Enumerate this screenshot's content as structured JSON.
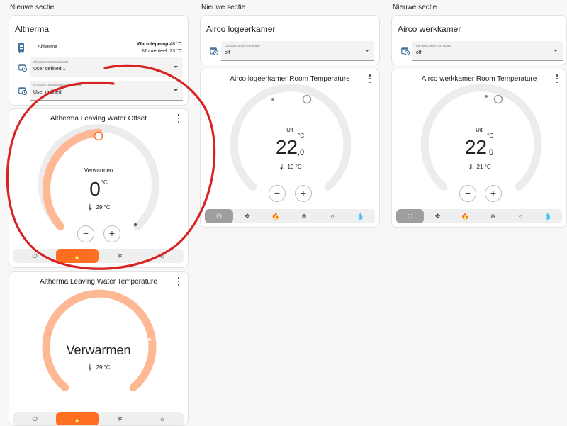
{
  "sections": [
    "Nieuwe sectie",
    "Nieuwe sectie",
    "Nieuwe sectie"
  ],
  "altherma": {
    "title": "Altherma",
    "entity": {
      "name": "Altherma",
      "state_label": "Warmtepomp",
      "state_value": "48 °C",
      "current_line": "Momenteel: 23 °C"
    },
    "climate_schedule": {
      "label": "ClimateControl Schedule",
      "value": "User defined 1"
    },
    "dhw_schedule": {
      "label": "DomesticHotWaterTank Schedule",
      "value": "User defined"
    }
  },
  "offset_card": {
    "title": "Altherma Leaving Water Offset",
    "mode": "Verwarmen",
    "target": "0",
    "unit": "°C",
    "current": "29 °C",
    "minus": "−",
    "plus": "+",
    "active_mode": "heat",
    "accent": "#ff6f22",
    "arc_color": "#ffb894"
  },
  "lwt_card": {
    "title": "Altherma Leaving Water Temperature",
    "mode": "Verwarmen",
    "current": "29 °C",
    "active_mode": "heat"
  },
  "airco_logeer": {
    "title": "Airco logeerkamer",
    "schedule": {
      "label": "ClimateControl Schedule",
      "value": "off"
    },
    "thermostat": {
      "title": "Airco logeerkamer Room Temperature",
      "mode": "Uit",
      "target_int": "22",
      "target_dec": ",0",
      "unit": "°C",
      "current": "19 °C",
      "active_mode": "off"
    }
  },
  "airco_werk": {
    "title": "Airco werkkamer",
    "schedule": {
      "label": "ClimateControl Schedule",
      "value": "off"
    },
    "thermostat": {
      "title": "Airco werkkamer Room Temperature",
      "mode": "Uit",
      "target_int": "22",
      "target_dec": ",0",
      "unit": "°C",
      "current": "21 °C",
      "active_mode": "off"
    }
  },
  "mode_icons": {
    "off": "power-icon",
    "fan": "fan-icon",
    "heat": "fire-icon",
    "cool": "snowflake-icon",
    "auto": "sun-snowflake-icon",
    "dry": "water-drop-icon"
  },
  "annotation_color": "#d92323"
}
